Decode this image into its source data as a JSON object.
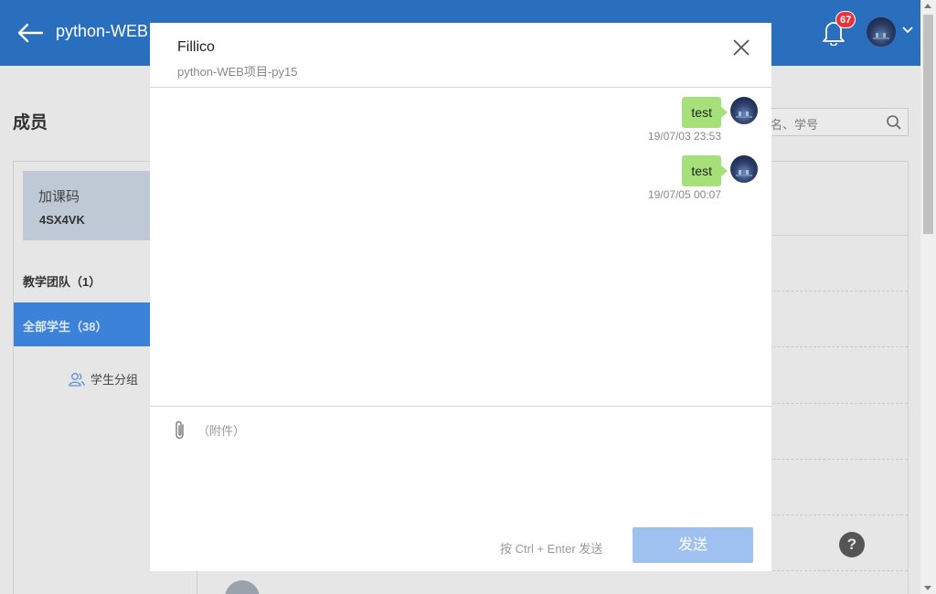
{
  "topbar": {
    "course_title": "python-WEB",
    "notification_count": "67"
  },
  "page": {
    "heading": "成员",
    "search_placeholder": "名、学号"
  },
  "sidebar": {
    "code_label": "加课码",
    "code_value": "4SX4VK",
    "team_label": "教学团队（1）",
    "students_label": "全部学生（38）",
    "group_label": "学生分组"
  },
  "modal": {
    "title": "Fillico",
    "subtitle": "python-WEB项目-py15",
    "messages": [
      {
        "text": "test",
        "time": "19/07/03 23:53"
      },
      {
        "text": "test",
        "time": "19/07/05 00:07"
      }
    ],
    "attach_label": "（附件）",
    "send_hint": "按 Ctrl + Enter 发送",
    "send_label": "发送"
  },
  "help_label": "?",
  "colors": {
    "topbar": "#2a6fbd",
    "accent": "#3b82d8",
    "bubble": "#a5e079",
    "send_button": "#9fc1ef",
    "badge": "#e8333c"
  },
  "icons": [
    "back-arrow-icon",
    "bell-icon",
    "chevron-down-icon",
    "search-icon",
    "users-icon",
    "close-icon",
    "paperclip-icon",
    "help-icon"
  ]
}
